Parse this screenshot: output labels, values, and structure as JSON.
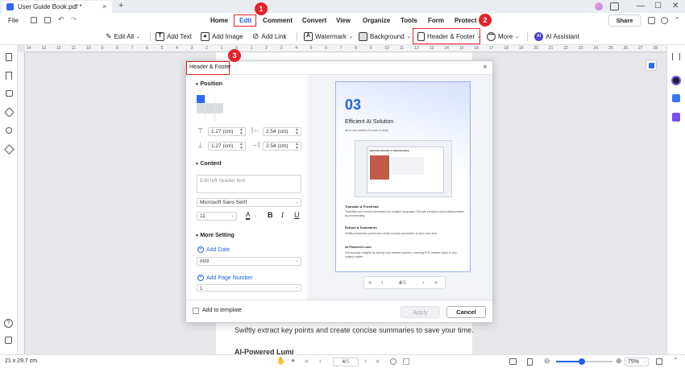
{
  "titlebar": {
    "tab_title": "User Guide Book.pdf *",
    "close": "×",
    "new_tab": "+"
  },
  "window": {
    "minimize": "—",
    "maximize": "☐",
    "close": "✕"
  },
  "menubar": {
    "file": "File",
    "home": "Home",
    "edit": "Edit",
    "comment": "Comment",
    "convert": "Convert",
    "view": "View",
    "organize": "Organize",
    "tools": "Tools",
    "form": "Form",
    "protect": "Protect",
    "share": "Share"
  },
  "toolbar": {
    "edit_all": "Edit All",
    "add_text": "Add Text",
    "add_image": "Add Image",
    "add_link": "Add Link",
    "watermark": "Watermark",
    "background": "Background",
    "header_footer": "Header & Footer",
    "more": "More",
    "ai_assistant": "AI Assistant"
  },
  "ruler": {
    "marks": [
      "14",
      "13",
      "12",
      "11",
      "10",
      "9",
      "8",
      "7",
      "6",
      "5",
      "4",
      "3",
      "2",
      "1",
      "0",
      "1",
      "2",
      "3",
      "4",
      "5",
      "6",
      "7",
      "8",
      "9",
      "10",
      "11",
      "12",
      "13",
      "14",
      "15",
      "16",
      "17",
      "18",
      "19",
      "20",
      "21",
      "22",
      "23",
      "24",
      "25",
      "26",
      "27",
      "28"
    ]
  },
  "doc": {
    "body_text": "Swiftly extract key points and create concise summaries to save your time.",
    "heading": "AI-Powered Lumi"
  },
  "modal": {
    "title": "Header & Footer",
    "position_label": "Position",
    "margins": {
      "top": "1.27 (cm)",
      "left": "2.54 (cm)",
      "bottom": "1.27 (cm)",
      "right": "2.54 (cm)"
    },
    "content_label": "Content",
    "header_placeholder": "Edit left header text",
    "font": "Microsoft Sans Serif",
    "font_size": "11",
    "more_setting_label": "More Setting",
    "add_date": "Add Date",
    "date_format": "m/d",
    "add_page_number": "Add Page Number",
    "page_number_format": "1",
    "add_to_template": "Add to template",
    "apply": "Apply",
    "cancel": "Cancel"
  },
  "preview": {
    "number": "03",
    "title": "Efficient AI Solution",
    "subtitle": "All-in-one solution for work & study.",
    "shot_title": "Brief Introduction to Wondershare",
    "h1": "Translate & Proofread",
    "p1": "Translate your current document into multiple languages. Elevate precision and professionalism by proofreading.",
    "h2": "Extract & Summarize",
    "p2": "Swiftly extract key points and create concise summaries to save your time.",
    "h3": "AI-Powered Lumi",
    "p3": "Get accurate insights by asking Lumi detailed queries, covering PDF-related topics or any subject matter.",
    "page_current": "4",
    "page_total": "/5"
  },
  "status": {
    "page_size": "21 x 29.7 cm",
    "page_current": "4",
    "page_total": "/5",
    "zoom": "75%",
    "zoom_fill": 0.45
  },
  "callouts": {
    "one": "1",
    "two": "2",
    "three": "3"
  }
}
